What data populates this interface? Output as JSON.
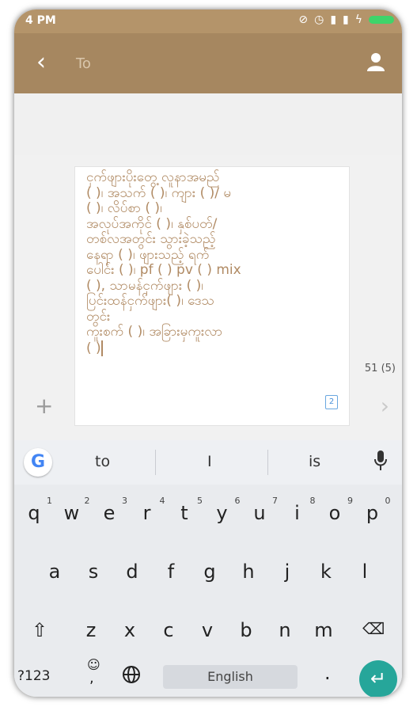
{
  "status_bar": {
    "time": "4 PM"
  },
  "app_bar": {
    "to_placeholder": "To"
  },
  "compose": {
    "message": "ငှက်ဖျားပိုးတွေ့ လူနာအမည်\n( )၊ အသက် ( )၊ ကျား ( )/ မ\n( )၊ လိပ်စာ ( )၊\nအလုပ်အကိုင် ( )၊ နှစ်ပတ်/\nတစ်လအတွင်း သွားခဲ့သည့်\nနေရာ ( )၊ ဖျားသည့် ရက်\nပေါင်း ( )၊ pf ( ) pv ( ) mix\n( ), သာမန်ငှက်ဖျား ( )၊\nပြင်းထန်ငှက်ဖျား( )၊ ဒေသ\nတွင်း\nကူးစက် ( )၊ အခြားမှကူးလာ\n( )",
    "char_count": "51 (5)",
    "sim_label": "2"
  },
  "keyboard": {
    "suggestions": [
      "to",
      "I",
      "is"
    ],
    "row1": [
      {
        "k": "q",
        "n": "1"
      },
      {
        "k": "w",
        "n": "2"
      },
      {
        "k": "e",
        "n": "3"
      },
      {
        "k": "r",
        "n": "4"
      },
      {
        "k": "t",
        "n": "5"
      },
      {
        "k": "y",
        "n": "6"
      },
      {
        "k": "u",
        "n": "7"
      },
      {
        "k": "i",
        "n": "8"
      },
      {
        "k": "o",
        "n": "9"
      },
      {
        "k": "p",
        "n": "0"
      }
    ],
    "row2": [
      "a",
      "s",
      "d",
      "f",
      "g",
      "h",
      "j",
      "k",
      "l"
    ],
    "row3": [
      "z",
      "x",
      "c",
      "v",
      "b",
      "n",
      "m"
    ],
    "symbols_key": "?123",
    "emoji_key": "☺",
    "comma_key": ",",
    "space_label": "English",
    "period_key": "."
  },
  "colors": {
    "accent": "#a68760",
    "text_brown": "#b08a63",
    "enter": "#26a69a"
  }
}
